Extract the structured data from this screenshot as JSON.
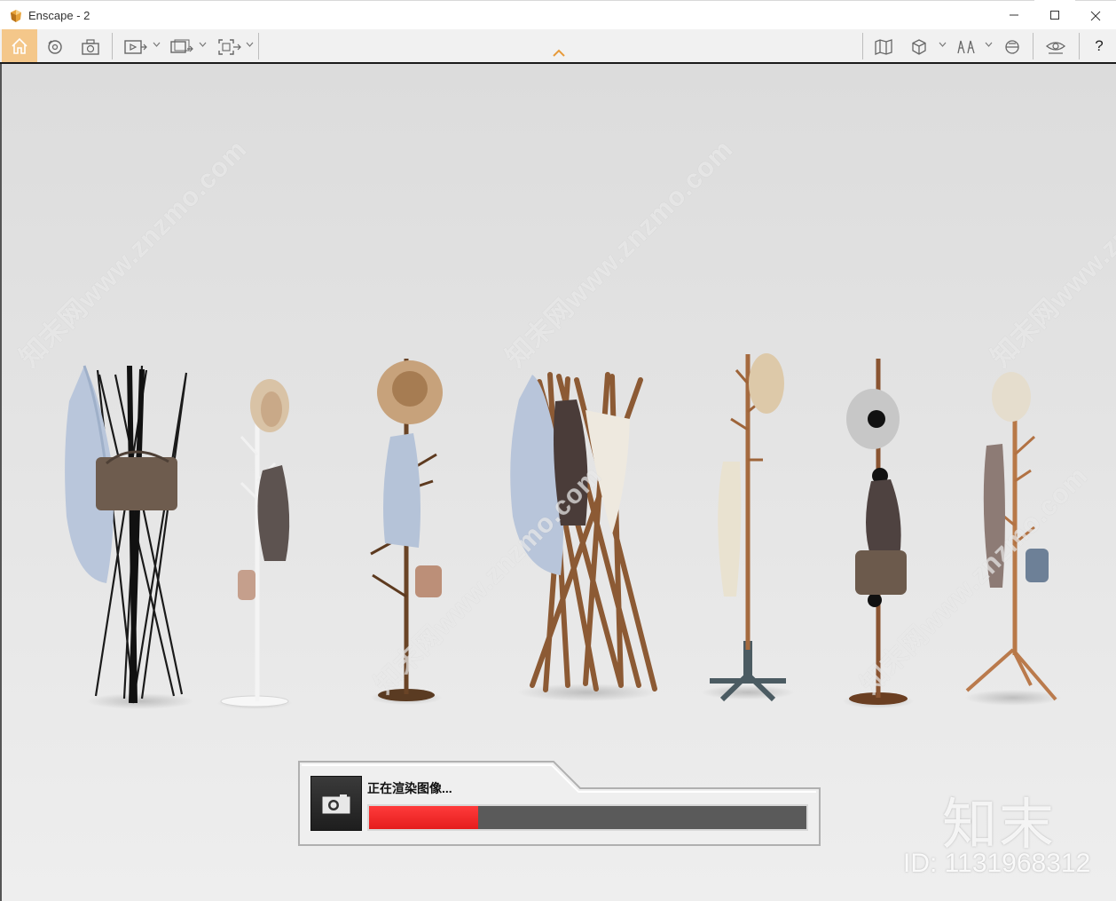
{
  "window": {
    "title": "Enscape - 2",
    "app_icon": "enscape-logo-icon",
    "controls": [
      "minimize-icon",
      "maximize-icon",
      "close-icon"
    ]
  },
  "toolbar": {
    "left_icons": [
      "home-icon",
      "orbit-icon",
      "screenshot-icon",
      "video-editor-icon",
      "batch-render-icon",
      "export-icon"
    ],
    "right_icons": [
      "map-icon",
      "view-cube-icon",
      "visual-settings-icon",
      "section-icon",
      "asset-visibility-icon"
    ],
    "help_label": "?",
    "collapse_icon": "chevron-up-icon",
    "accent_color": "#f4c78a"
  },
  "viewport": {
    "watermark_text": "知末网www.znzmo.com",
    "brand_text": "知末",
    "id_text": "ID: 1131968312"
  },
  "render_dialog": {
    "label": "正在渲染图像...",
    "icon": "camera-icon",
    "progress_fraction": 0.25,
    "progress_color": "#ff2a2a"
  }
}
